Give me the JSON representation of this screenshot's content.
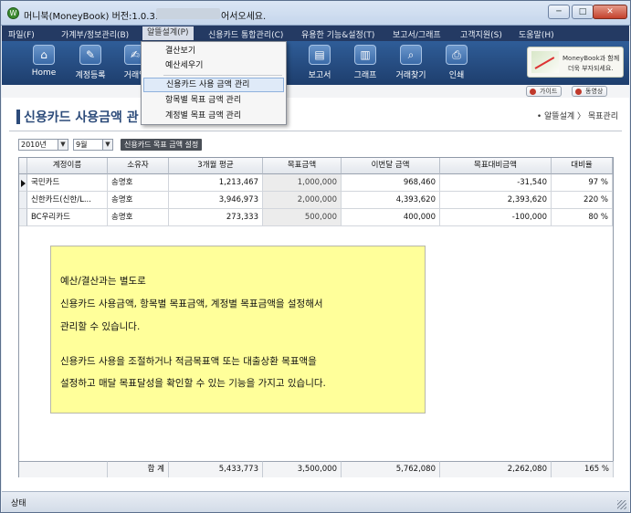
{
  "window": {
    "title_prefix": "머니북(MoneyBook) 버전:1.0.3.25 -",
    "title_suffix": "어서오세요.",
    "minimize": "─",
    "maximize": "□",
    "close": "✕"
  },
  "menubar": [
    "파일(F)",
    "가계부/정보관리(B)",
    "알뜰설계(P)",
    "신용카드 통합관리(C)",
    "유용한 기능&설정(T)",
    "보고서/그래프",
    "고객지원(S)",
    "도움말(H)"
  ],
  "toolbar": {
    "items": [
      {
        "label": "Home",
        "icon": "home-icon"
      },
      {
        "label": "계정등록",
        "icon": "account-register-icon"
      },
      {
        "label": "거래입",
        "icon": "transaction-entry-icon"
      },
      {
        "label": "보고서",
        "icon": "report-icon"
      },
      {
        "label": "그래프",
        "icon": "graph-icon"
      },
      {
        "label": "거래찾기",
        "icon": "search-icon"
      },
      {
        "label": "인쇄",
        "icon": "print-icon"
      }
    ],
    "banner_line1": "MoneyBook과 함께",
    "banner_line2": "더욱 부자되세요."
  },
  "dropdown": [
    "결산보기",
    "예산세우기",
    "신용카드 사용 금액 관리",
    "항목별 목표 금액 관리",
    "계정별 목표 금액 관리"
  ],
  "helpbar": {
    "guide": "가이드",
    "video": "동영상"
  },
  "page": {
    "title": "신용카드 사용금액 관",
    "breadcrumb": "• 알뜰설계 〉 목표관리"
  },
  "filters": {
    "year": "2010년",
    "month": "9월",
    "set_button": "신용카드 목표 금액 설정"
  },
  "table": {
    "columns": [
      "계정이름",
      "소유자",
      "3개월 평균",
      "목표금액",
      "이번달 금액",
      "목표대비금액",
      "대비율"
    ],
    "rows": [
      [
        "국민카드",
        "송명호",
        "1,213,467",
        "1,000,000",
        "968,460",
        "-31,540",
        "97 %"
      ],
      [
        "신한카드(신한/L...",
        "송명호",
        "3,946,973",
        "2,000,000",
        "4,393,620",
        "2,393,620",
        "220 %"
      ],
      [
        "BC우리카드",
        "송명호",
        "273,333",
        "500,000",
        "400,000",
        "-100,000",
        "80 %"
      ]
    ],
    "total": {
      "label": "합 계",
      "avg": "5,433,773",
      "goal": "3,500,000",
      "current": "5,762,080",
      "diff": "2,262,080",
      "ratio": "165 %"
    }
  },
  "note": [
    "예산/결산과는 별도로",
    "신용카드 사용금액, 항목별 목표금액, 계정별 목표금액을 설정해서",
    "관리할 수 있습니다.",
    "신용카드 사용을 조절하거나 적금목표액 또는 대출상환 목표액을",
    "설정하고 매달 목표달성을 확인할 수 있는 기능을 가지고 있습니다."
  ],
  "statusbar": {
    "text": "상태"
  }
}
